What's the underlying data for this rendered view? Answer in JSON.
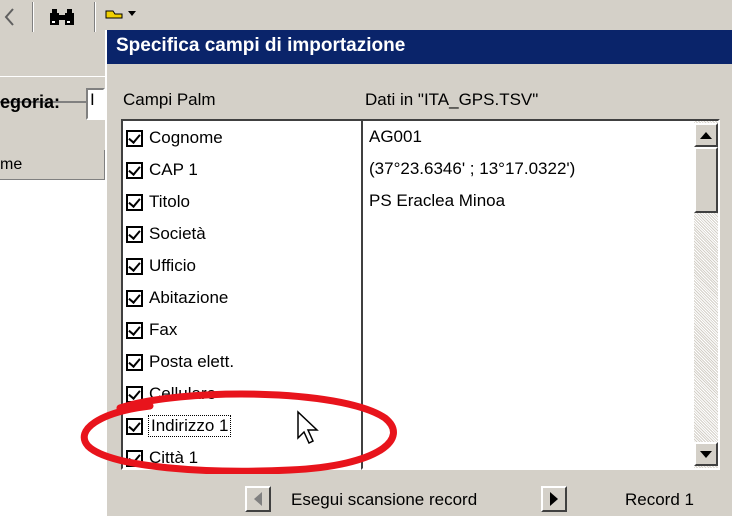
{
  "app": {
    "category_label": "egoria:",
    "category_value": "I",
    "column_header": "me",
    "toolbar": [
      {
        "name": "back-arrow-icon"
      },
      {
        "name": "binoculars-icon"
      },
      {
        "name": "folder-dropdown-icon"
      }
    ]
  },
  "dialog": {
    "title": "Specifica campi di importazione",
    "fields_header": "Campi Palm",
    "data_header": "Dati in   \"ITA_GPS.TSV\"",
    "fields": [
      {
        "label": "Cognome",
        "checked": true
      },
      {
        "label": "CAP 1",
        "checked": true
      },
      {
        "label": "Titolo",
        "checked": true
      },
      {
        "label": "Società",
        "checked": true
      },
      {
        "label": "Ufficio",
        "checked": true
      },
      {
        "label": "Abitazione",
        "checked": true
      },
      {
        "label": "Fax",
        "checked": true
      },
      {
        "label": "Posta elett.",
        "checked": true
      },
      {
        "label": "Cellulare",
        "checked": true
      },
      {
        "label": "Indirizzo 1",
        "checked": true
      },
      {
        "label": "Città 1",
        "checked": true
      }
    ],
    "data_values": [
      "AG001",
      "(37°23.6346' ; 13°17.0322')",
      "PS Eraclea Minoa"
    ],
    "nav": {
      "scan_label": "Esegui scansione record",
      "record_label": "Record 1"
    }
  },
  "colors": {
    "face": "#d4d0c8",
    "titlebar": "#0a246a",
    "annotation": "#e8141c"
  }
}
